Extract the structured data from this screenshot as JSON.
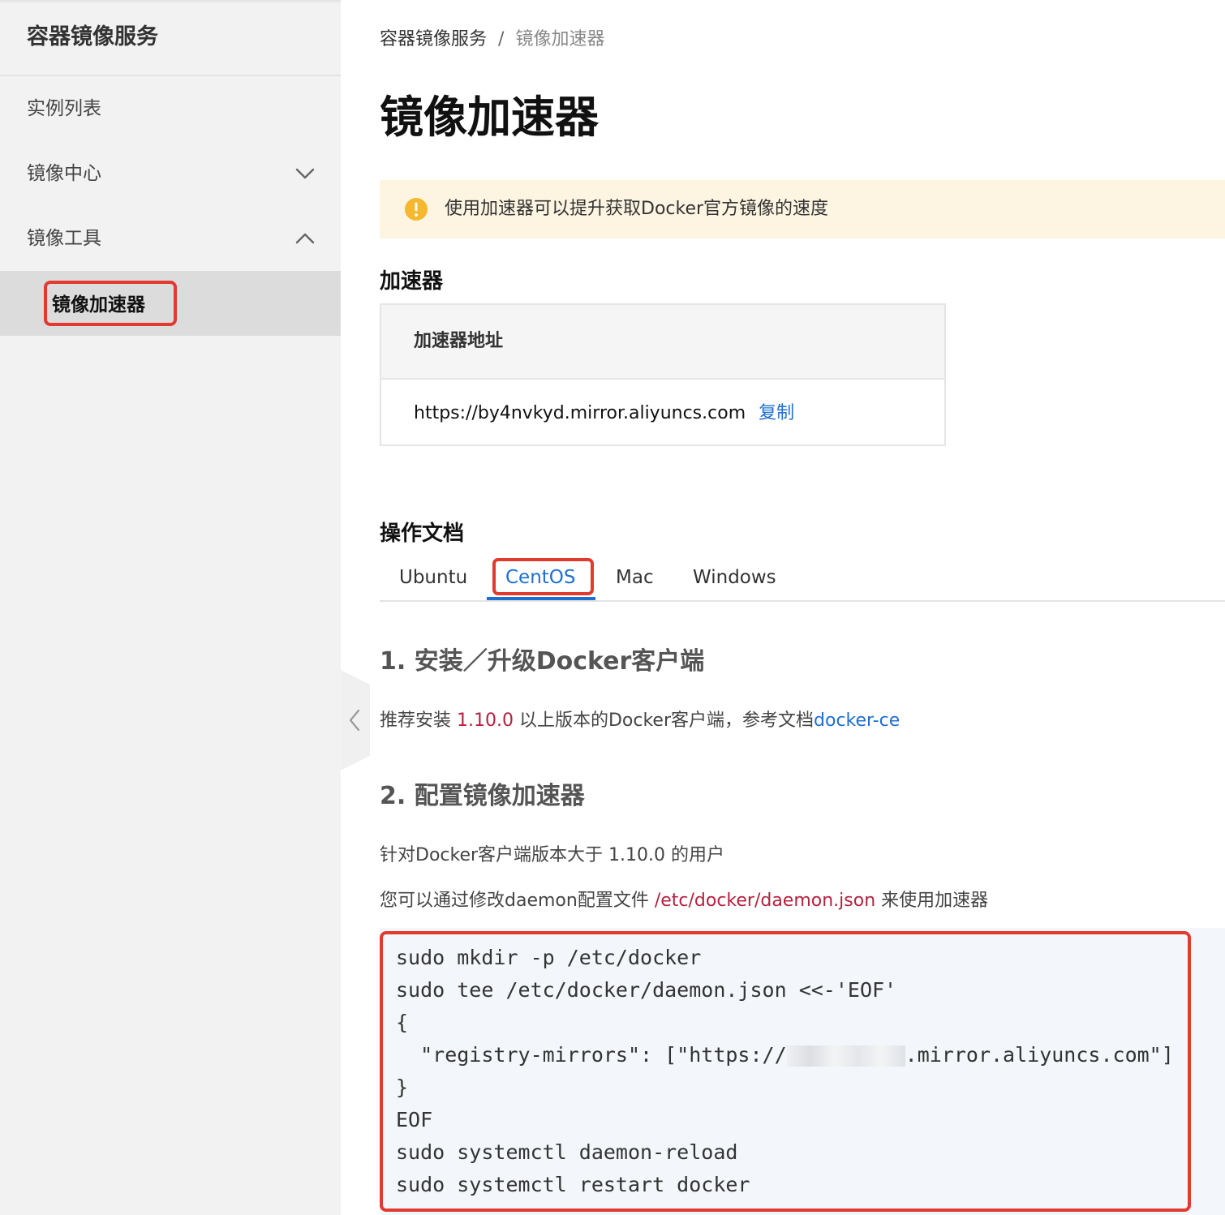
{
  "sidebar": {
    "title": "容器镜像服务",
    "items": [
      {
        "label": "实例列表"
      },
      {
        "label": "镜像中心",
        "expanded": false
      },
      {
        "label": "镜像工具",
        "expanded": true
      }
    ],
    "active_sub_item": "镜像加速器"
  },
  "breadcrumb": {
    "root": "容器镜像服务",
    "separator": "/",
    "current": "镜像加速器"
  },
  "page_title": "镜像加速器",
  "notice": {
    "text": "使用加速器可以提升获取Docker官方镜像的速度",
    "icon": "warning-icon"
  },
  "accelerator": {
    "section_title": "加速器",
    "header": "加速器地址",
    "url": "https://by4nvkyd.mirror.aliyuncs.com",
    "copy_label": "复制"
  },
  "docs": {
    "section_title": "操作文档",
    "tabs": [
      "Ubuntu",
      "CentOS",
      "Mac",
      "Windows"
    ],
    "active_tab": "CentOS"
  },
  "step1": {
    "title": "1. 安装／升级Docker客户端",
    "text_before": "推荐安装 ",
    "version": "1.10.0",
    "text_after": " 以上版本的Docker客户端，参考文档",
    "link": "docker-ce"
  },
  "step2": {
    "title": "2. 配置镜像加速器",
    "line1": "针对Docker客户端版本大于 1.10.0 的用户",
    "line2_before": "您可以通过修改daemon配置文件 ",
    "line2_path": "/etc/docker/daemon.json",
    "line2_after": " 来使用加速器"
  },
  "code_lines": [
    "sudo mkdir -p /etc/docker",
    "sudo tee /etc/docker/daemon.json <<-'EOF'",
    "{",
    "  \"registry-mirrors\": [\"https://",
    "}",
    "EOF",
    "sudo systemctl daemon-reload",
    "sudo systemctl restart docker"
  ],
  "code_mirror_suffix": ".mirror.aliyuncs.com\"]",
  "colors": {
    "accent": "#1f6fd1",
    "highlight_red": "#e23a2e",
    "notice_bg": "#fdf5e1",
    "warning": "#f5b82e",
    "version_red": "#b5223f"
  }
}
